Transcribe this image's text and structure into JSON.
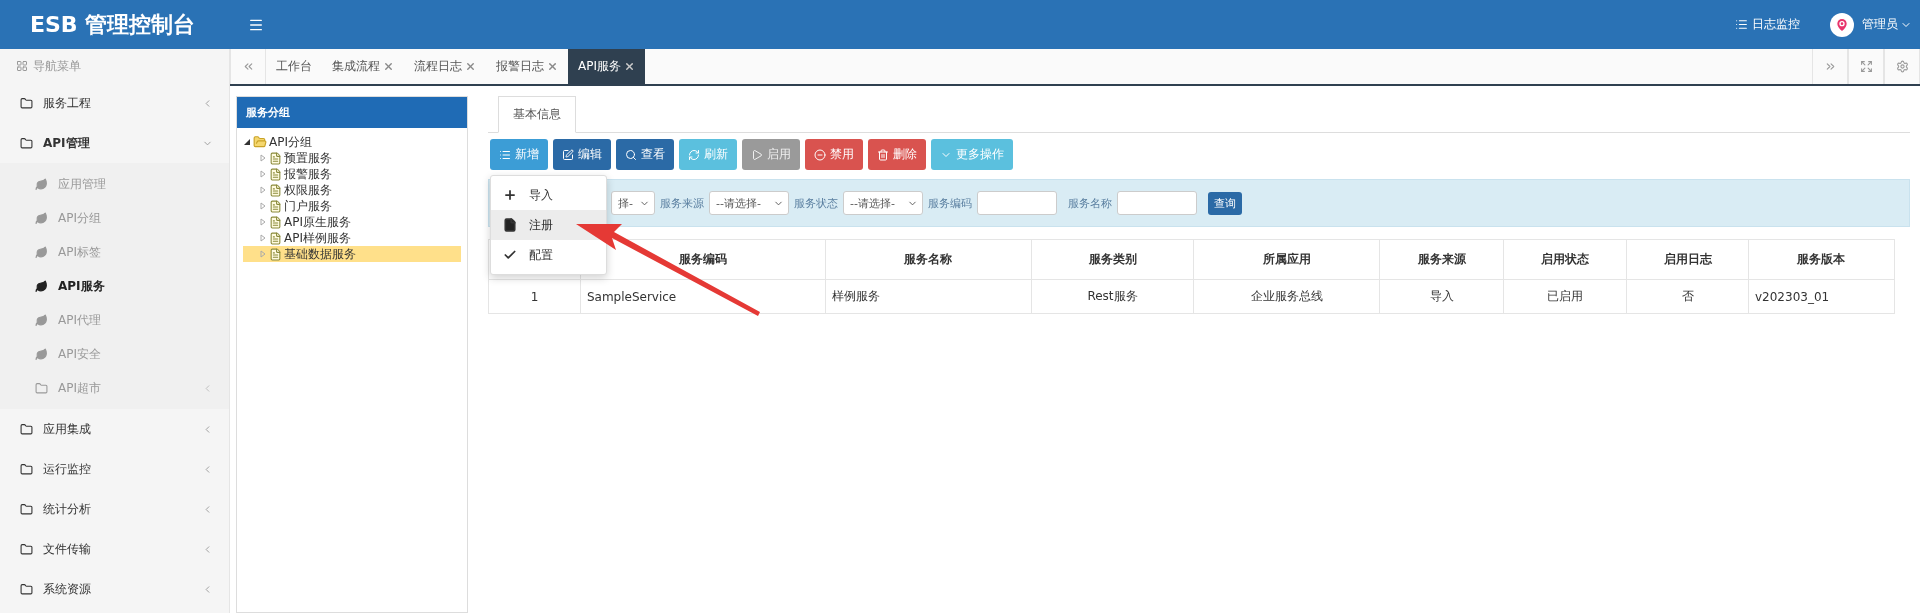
{
  "header": {
    "title": "ESB 管理控制台",
    "links": [
      {
        "label": "日志监控"
      }
    ],
    "user": {
      "name": "管理员"
    }
  },
  "sidebar": {
    "title": "导航菜单",
    "items": [
      {
        "label": "服务工程",
        "expanded": false
      },
      {
        "label": "API管理",
        "expanded": true,
        "children": [
          {
            "label": "应用管理",
            "kind": "page",
            "selected": false
          },
          {
            "label": "API分组",
            "kind": "page",
            "selected": false
          },
          {
            "label": "API标签",
            "kind": "page",
            "selected": false
          },
          {
            "label": "API服务",
            "kind": "page",
            "selected": true
          },
          {
            "label": "API代理",
            "kind": "page",
            "selected": false
          },
          {
            "label": "API安全",
            "kind": "page",
            "selected": false
          },
          {
            "label": "API超市",
            "kind": "group",
            "selected": false
          }
        ]
      },
      {
        "label": "应用集成",
        "expanded": false
      },
      {
        "label": "运行监控",
        "expanded": false
      },
      {
        "label": "统计分析",
        "expanded": false
      },
      {
        "label": "文件传输",
        "expanded": false
      },
      {
        "label": "系统资源",
        "expanded": false
      }
    ]
  },
  "tabs": [
    {
      "label": "工作台",
      "closable": false,
      "selected": false
    },
    {
      "label": "集成流程",
      "closable": true,
      "selected": false
    },
    {
      "label": "流程日志",
      "closable": true,
      "selected": false
    },
    {
      "label": "报警日志",
      "closable": true,
      "selected": false
    },
    {
      "label": "API服务",
      "closable": true,
      "selected": true
    }
  ],
  "tree": {
    "title": "服务分组",
    "root": {
      "label": "API分组",
      "expanded": true,
      "children": [
        {
          "label": "预置服务",
          "selected": false
        },
        {
          "label": "报警服务",
          "selected": false
        },
        {
          "label": "权限服务",
          "selected": false
        },
        {
          "label": "门户服务",
          "selected": false
        },
        {
          "label": "API原生服务",
          "selected": false
        },
        {
          "label": "API样例服务",
          "selected": false
        },
        {
          "label": "基础数据服务",
          "selected": true
        }
      ]
    }
  },
  "panel_tabs": [
    {
      "label": "基本信息",
      "selected": true
    }
  ],
  "toolbar": [
    {
      "label": "新增",
      "kind": "add",
      "disabled": false
    },
    {
      "label": "编辑",
      "kind": "edit",
      "disabled": false
    },
    {
      "label": "查看",
      "kind": "view",
      "disabled": false
    },
    {
      "label": "刷新",
      "kind": "refresh",
      "disabled": false
    },
    {
      "label": "启用",
      "kind": "enable",
      "disabled": true
    },
    {
      "label": "禁用",
      "kind": "disable",
      "disabled": false
    },
    {
      "label": "删除",
      "kind": "delete",
      "disabled": false
    },
    {
      "label": "更多操作",
      "kind": "more",
      "disabled": false
    }
  ],
  "dropdown": {
    "items": [
      {
        "label": "导入",
        "kind": "plus",
        "selected": false
      },
      {
        "label": "注册",
        "kind": "file",
        "selected": true
      },
      {
        "label": "配置",
        "kind": "check",
        "selected": false
      }
    ]
  },
  "filters": [
    {
      "kind": "select",
      "value": "择-"
    },
    {
      "kind": "select",
      "label": "服务来源",
      "value": "--请选择-"
    },
    {
      "kind": "select",
      "label": "服务状态",
      "value": "--请选择-"
    },
    {
      "kind": "input",
      "label": "服务编码"
    },
    {
      "kind": "input",
      "label": "服务名称"
    }
  ],
  "search_button": "查询",
  "table": {
    "columns": [
      "",
      "服务编码",
      "服务名称",
      "服务类别",
      "所属应用",
      "服务来源",
      "启用状态",
      "启用日志",
      "服务版本"
    ],
    "rows": [
      {
        "cells": [
          "1",
          "SampleService",
          "样例服务",
          "Rest服务",
          "企业服务总线",
          "导入",
          "已启用",
          "否",
          "v202303_01"
        ]
      }
    ]
  }
}
